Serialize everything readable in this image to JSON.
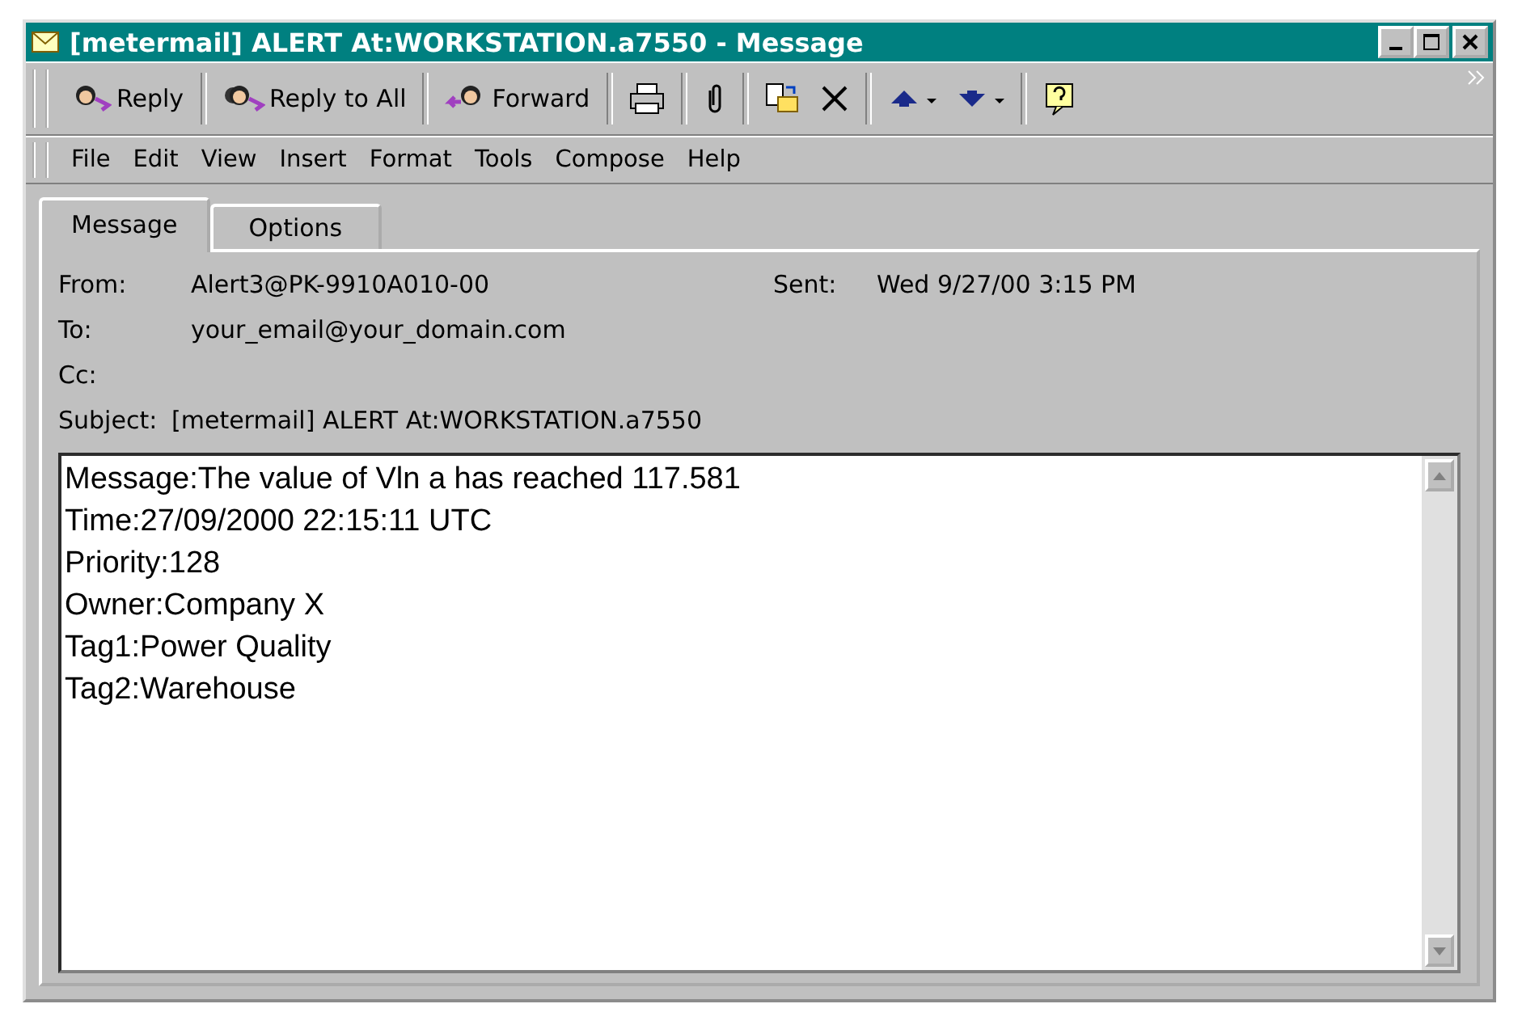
{
  "window": {
    "title": "[metermail] ALERT At:WORKSTATION.a7550 - Message"
  },
  "toolbar": {
    "buttons": [
      {
        "label": "Reply"
      },
      {
        "label": "Reply to All"
      },
      {
        "label": "Forward"
      }
    ]
  },
  "menu": [
    "File",
    "Edit",
    "View",
    "Insert",
    "Format",
    "Tools",
    "Compose",
    "Help"
  ],
  "tabs": [
    {
      "label": "Message",
      "selected": true
    },
    {
      "label": "Options",
      "selected": false
    }
  ],
  "header": {
    "from_label": "From:",
    "from": "Alert3@PK-9910A010-00",
    "sent_label": "Sent:",
    "sent": "Wed 9/27/00 3:15 PM",
    "to_label": "To:",
    "to": "your_email@your_domain.com",
    "cc_label": "Cc:",
    "subject_label": "Subject:",
    "subject": "[metermail] ALERT At:WORKSTATION.a7550"
  },
  "body": [
    "Message:The value of Vln a has reached 117.581",
    "Time:27/09/2000 22:15:11 UTC",
    "Priority:128",
    "Owner:Company X",
    "Tag1:Power Quality",
    "Tag2:Warehouse"
  ]
}
